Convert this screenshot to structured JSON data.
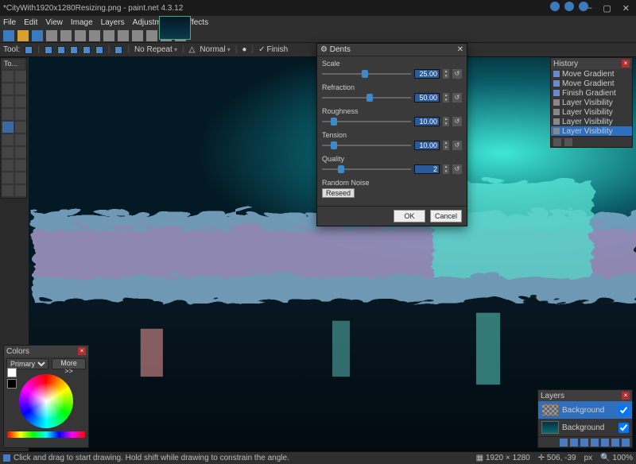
{
  "app": {
    "title": "*CityWith1920x1280Resizing.png - paint.net 4.3.12"
  },
  "menu": [
    "File",
    "Edit",
    "View",
    "Image",
    "Layers",
    "Adjustments",
    "Effects"
  ],
  "options": {
    "tool_label": "Tool:",
    "repeat": "No Repeat",
    "blend": "Normal",
    "finish": "Finish"
  },
  "tools_panel": {
    "title": "To..."
  },
  "dialog": {
    "title": "Dents",
    "params": [
      {
        "label": "Scale",
        "value": "25.00",
        "pos": 45
      },
      {
        "label": "Refraction",
        "value": "50.00",
        "pos": 50
      },
      {
        "label": "Roughness",
        "value": "10.00",
        "pos": 10
      },
      {
        "label": "Tension",
        "value": "10.00",
        "pos": 10
      },
      {
        "label": "Quality",
        "value": "2",
        "pos": 18
      }
    ],
    "noise_label": "Random Noise",
    "reseed": "Reseed",
    "ok": "OK",
    "cancel": "Cancel"
  },
  "history": {
    "title": "History",
    "items": [
      {
        "label": "Move Gradient",
        "icon": "grad"
      },
      {
        "label": "Move Gradient",
        "icon": "grad"
      },
      {
        "label": "Finish Gradient",
        "icon": "grad"
      },
      {
        "label": "Layer Visibility",
        "icon": "eye"
      },
      {
        "label": "Layer Visibility",
        "icon": "eye"
      },
      {
        "label": "Layer Visibility",
        "icon": "eye"
      },
      {
        "label": "Layer Visibility",
        "icon": "eye",
        "selected": true
      }
    ]
  },
  "layers": {
    "title": "Layers",
    "items": [
      {
        "name": "Background",
        "selected": true,
        "thumb": "checker",
        "checked": true
      },
      {
        "name": "Background",
        "selected": false,
        "thumb": "image",
        "checked": true
      }
    ]
  },
  "colors": {
    "title": "Colors",
    "mode": "Primary",
    "more": "More >>"
  },
  "status": {
    "hint": "Click and drag to start drawing. Hold shift while drawing to constrain the angle.",
    "dims": "1920 × 1280",
    "cursor": "506, -39",
    "unit": "px",
    "zoom": "100%"
  }
}
